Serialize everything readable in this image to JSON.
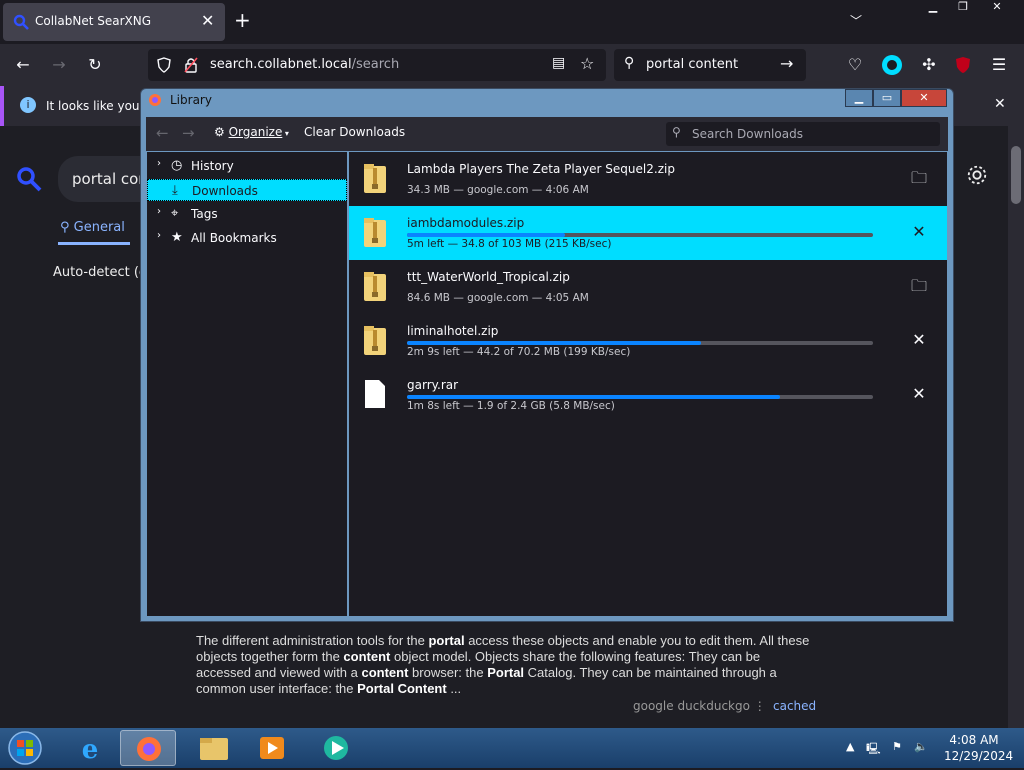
{
  "browser": {
    "tab_title": "CollabNet SearXNG",
    "url_host": "search.collabnet.local",
    "url_path": "/search",
    "search_text": "portal content",
    "notification": "It looks like you ha"
  },
  "page": {
    "query": "portal cor",
    "tab_general": "General",
    "autodetect": "Auto-detect (er",
    "snippet_parts": [
      "The different administration tools for the ",
      "portal",
      " access these objects and enable you to edit them. All these objects together form the ",
      "content",
      " object model. Objects share the following features: They can be accessed and viewed with a ",
      "content",
      " browser: the ",
      "Portal",
      " Catalog. They can be maintained through a common user interface: the ",
      "Portal Content",
      " ..."
    ],
    "engine1": "google",
    "engine2": "duckduckgo",
    "cached": "cached"
  },
  "library": {
    "title": "Library",
    "organize": "Organize",
    "clear": "Clear Downloads",
    "search_placeholder": "Search Downloads",
    "tree": [
      {
        "label": "History",
        "icon": "clock-icon",
        "twisty": "›"
      },
      {
        "label": "Downloads",
        "icon": "download-icon",
        "twisty": ""
      },
      {
        "label": "Tags",
        "icon": "tag-icon",
        "twisty": "›"
      },
      {
        "label": "All Bookmarks",
        "icon": "star-icon",
        "twisty": "›"
      }
    ],
    "downloads": [
      {
        "name": "Lambda Players The Zeta Player Sequel2.zip",
        "status": "34.3 MB — google.com — 4:06 AM",
        "progress": null,
        "action": "folder-icon",
        "icon": "zip-folder-icon"
      },
      {
        "name": "iambdamodules.zip",
        "status": "5m left — 34.8 of 103 MB (215 KB/sec)",
        "progress": 0.34,
        "action": "cancel-icon",
        "icon": "zip-folder-icon"
      },
      {
        "name": "ttt_WaterWorld_Tropical.zip",
        "status": "84.6 MB — google.com — 4:05 AM",
        "progress": null,
        "action": "folder-icon",
        "icon": "zip-folder-icon"
      },
      {
        "name": "liminalhotel.zip",
        "status": "2m 9s left — 44.2 of 70.2 MB (199 KB/sec)",
        "progress": 0.63,
        "action": "cancel-icon",
        "icon": "zip-folder-icon"
      },
      {
        "name": "garry.rar",
        "status": "1m 8s left — 1.9 of 2.4 GB (5.8 MB/sec)",
        "progress": 0.8,
        "action": "cancel-icon",
        "icon": "file-icon"
      }
    ]
  },
  "taskbar": {
    "time": "4:08 AM",
    "date": "12/29/2024"
  }
}
